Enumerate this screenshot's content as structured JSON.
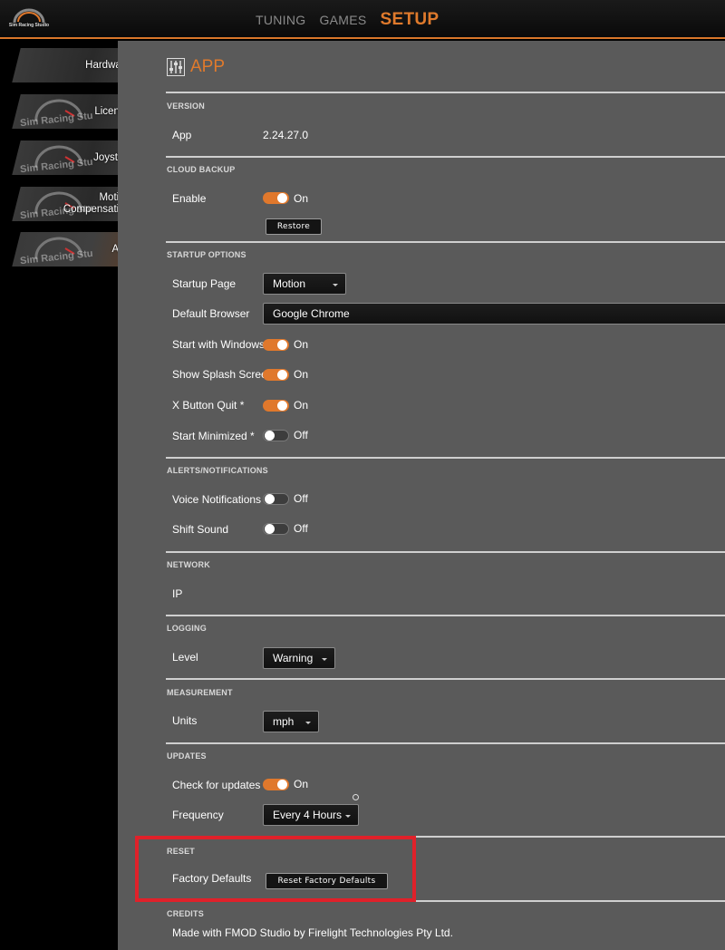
{
  "app": {
    "logo_text": "Sim Racing Studio"
  },
  "nav": {
    "tuning": "TUNING",
    "games": "GAMES",
    "setup": "SETUP"
  },
  "sidebar": {
    "deco_text": "Sim Racing Stu",
    "items": [
      {
        "label": "Hardware"
      },
      {
        "label": "License"
      },
      {
        "label": "Joystick"
      },
      {
        "label_line1": "Motion",
        "label_line2": "Compensation"
      },
      {
        "label": "App"
      }
    ]
  },
  "page": {
    "title": "APP",
    "icon": "sliders-icon"
  },
  "version": {
    "section": "VERSION",
    "app_label": "App",
    "app_value": "2.24.27.0"
  },
  "cloud_backup": {
    "section": "CLOUD BACKUP",
    "enable_label": "Enable",
    "enable_state": "On",
    "restore_button": "Restore"
  },
  "startup": {
    "section": "STARTUP OPTIONS",
    "startup_page_label": "Startup Page",
    "startup_page_value": "Motion",
    "browser_label": "Default Browser",
    "browser_value": "Google Chrome",
    "start_windows_label": "Start with Windows",
    "start_windows_state": "On",
    "splash_label": "Show Splash Screen",
    "splash_state": "On",
    "xquit_label": "X Button Quit *",
    "xquit_state": "On",
    "minimized_label": "Start Minimized *",
    "minimized_state": "Off"
  },
  "alerts": {
    "section": "ALERTS/NOTIFICATIONS",
    "voice_label": "Voice Notifications",
    "voice_state": "Off",
    "shift_label": "Shift Sound",
    "shift_state": "Off"
  },
  "network": {
    "section": "NETWORK",
    "ip_label": "IP"
  },
  "logging": {
    "section": "LOGGING",
    "level_label": "Level",
    "level_value": "Warning"
  },
  "measurement": {
    "section": "MEASUREMENT",
    "units_label": "Units",
    "units_value": "mph"
  },
  "updates": {
    "section": "UPDATES",
    "check_label": "Check for updates",
    "check_state": "On",
    "frequency_label": "Frequency",
    "frequency_value": "Every 4 Hours"
  },
  "reset": {
    "section": "RESET",
    "factory_label": "Factory Defaults",
    "factory_button": "Reset Factory Defaults"
  },
  "credits": {
    "section": "CREDITS",
    "text": "Made with FMOD Studio by Firelight Technologies Pty Ltd."
  },
  "colors": {
    "accent": "#e07a2c",
    "panel": "#5a5a5a",
    "highlight": "#e0212a"
  }
}
